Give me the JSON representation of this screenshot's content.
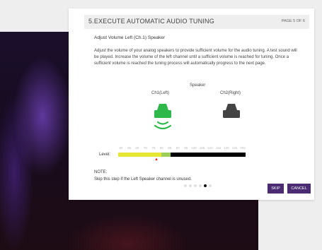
{
  "dialog": {
    "title": "5.EXECUTE AUTOMATIC AUDIO TUNING",
    "page_indicator": "PAGE 5 OF 6",
    "subtitle": "Adjust Volume Left (Ch.1) Speaker",
    "instructions": "Adjust the volume of your analog speakers to provide sufficient volume for the audio tuning. A test sound will be played. Increase the volume of the left channel until a sufficient volume is reached for tuning. Once a sufficient volume is reached the tuning process will automatically progress to the next page."
  },
  "speakers": {
    "heading": "Speaker",
    "left_label": "Ch1(Left)",
    "right_label": "Ch2(Right)",
    "left_color": "#2fb84a",
    "right_color": "#444444",
    "active": "left"
  },
  "level": {
    "label": "Level:",
    "ticks": [
      "60",
      "65",
      "65",
      "70",
      "75",
      "80",
      "85",
      "90",
      "95",
      "100",
      "105",
      "110",
      "115",
      "120",
      "125",
      "204"
    ],
    "yellow_end_fraction": 0.34,
    "green_end_fraction": 0.41,
    "marker_fraction": 0.3,
    "marker_glyph": "▲",
    "colors": {
      "yellow": "#e7e634",
      "green": "#9ccf57",
      "empty": "#000000",
      "marker": "#dd2222"
    }
  },
  "note": {
    "label": "NOTE:",
    "text": "Skip this step if the Left Speaker channel is unused."
  },
  "pager": {
    "total": 6,
    "current": 5
  },
  "buttons": {
    "skip": "SKIP",
    "cancel": "CANCEL",
    "color": "#4b2c73"
  }
}
